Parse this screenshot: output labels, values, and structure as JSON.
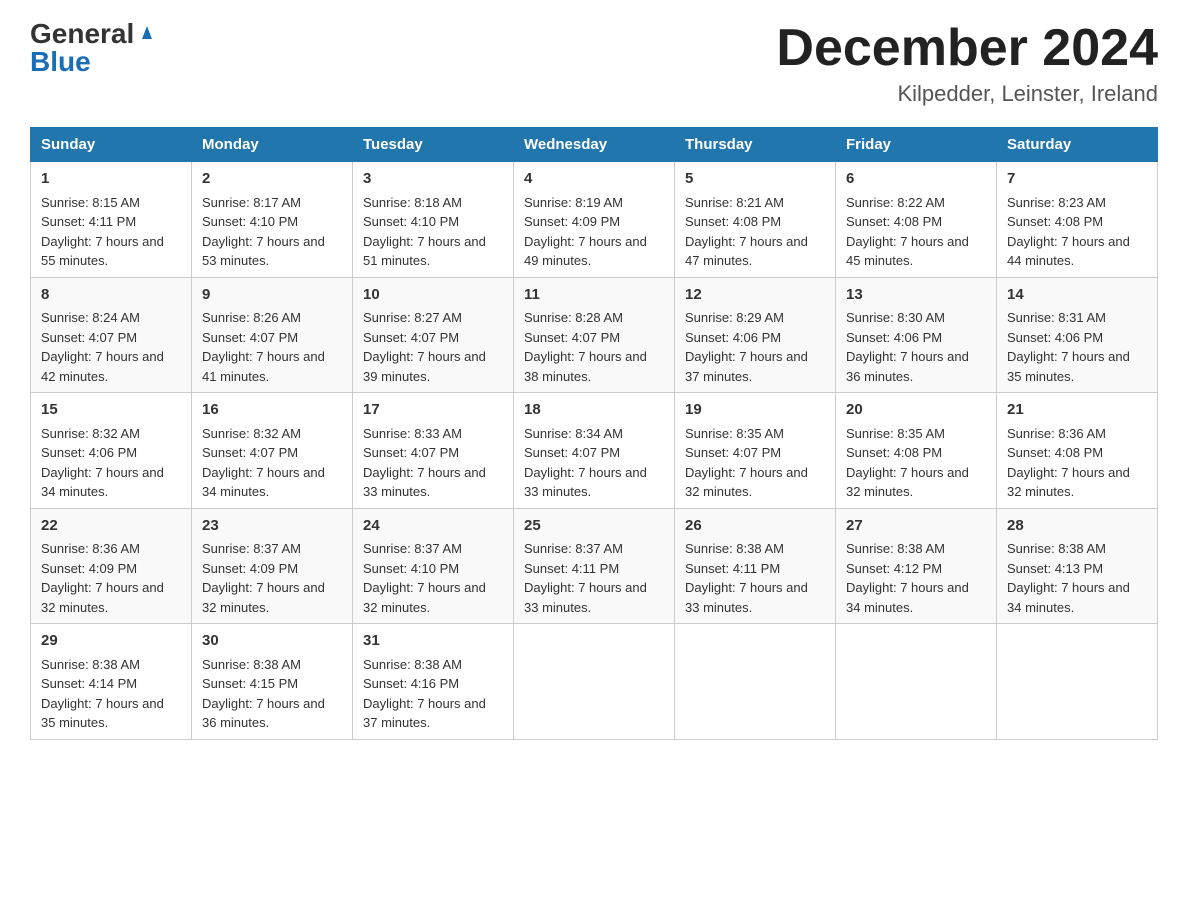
{
  "header": {
    "logo_general": "General",
    "logo_blue": "Blue",
    "month_title": "December 2024",
    "location": "Kilpedder, Leinster, Ireland"
  },
  "weekdays": [
    "Sunday",
    "Monday",
    "Tuesday",
    "Wednesday",
    "Thursday",
    "Friday",
    "Saturday"
  ],
  "weeks": [
    [
      {
        "day": "1",
        "sunrise": "8:15 AM",
        "sunset": "4:11 PM",
        "daylight": "7 hours and 55 minutes."
      },
      {
        "day": "2",
        "sunrise": "8:17 AM",
        "sunset": "4:10 PM",
        "daylight": "7 hours and 53 minutes."
      },
      {
        "day": "3",
        "sunrise": "8:18 AM",
        "sunset": "4:10 PM",
        "daylight": "7 hours and 51 minutes."
      },
      {
        "day": "4",
        "sunrise": "8:19 AM",
        "sunset": "4:09 PM",
        "daylight": "7 hours and 49 minutes."
      },
      {
        "day": "5",
        "sunrise": "8:21 AM",
        "sunset": "4:08 PM",
        "daylight": "7 hours and 47 minutes."
      },
      {
        "day": "6",
        "sunrise": "8:22 AM",
        "sunset": "4:08 PM",
        "daylight": "7 hours and 45 minutes."
      },
      {
        "day": "7",
        "sunrise": "8:23 AM",
        "sunset": "4:08 PM",
        "daylight": "7 hours and 44 minutes."
      }
    ],
    [
      {
        "day": "8",
        "sunrise": "8:24 AM",
        "sunset": "4:07 PM",
        "daylight": "7 hours and 42 minutes."
      },
      {
        "day": "9",
        "sunrise": "8:26 AM",
        "sunset": "4:07 PM",
        "daylight": "7 hours and 41 minutes."
      },
      {
        "day": "10",
        "sunrise": "8:27 AM",
        "sunset": "4:07 PM",
        "daylight": "7 hours and 39 minutes."
      },
      {
        "day": "11",
        "sunrise": "8:28 AM",
        "sunset": "4:07 PM",
        "daylight": "7 hours and 38 minutes."
      },
      {
        "day": "12",
        "sunrise": "8:29 AM",
        "sunset": "4:06 PM",
        "daylight": "7 hours and 37 minutes."
      },
      {
        "day": "13",
        "sunrise": "8:30 AM",
        "sunset": "4:06 PM",
        "daylight": "7 hours and 36 minutes."
      },
      {
        "day": "14",
        "sunrise": "8:31 AM",
        "sunset": "4:06 PM",
        "daylight": "7 hours and 35 minutes."
      }
    ],
    [
      {
        "day": "15",
        "sunrise": "8:32 AM",
        "sunset": "4:06 PM",
        "daylight": "7 hours and 34 minutes."
      },
      {
        "day": "16",
        "sunrise": "8:32 AM",
        "sunset": "4:07 PM",
        "daylight": "7 hours and 34 minutes."
      },
      {
        "day": "17",
        "sunrise": "8:33 AM",
        "sunset": "4:07 PM",
        "daylight": "7 hours and 33 minutes."
      },
      {
        "day": "18",
        "sunrise": "8:34 AM",
        "sunset": "4:07 PM",
        "daylight": "7 hours and 33 minutes."
      },
      {
        "day": "19",
        "sunrise": "8:35 AM",
        "sunset": "4:07 PM",
        "daylight": "7 hours and 32 minutes."
      },
      {
        "day": "20",
        "sunrise": "8:35 AM",
        "sunset": "4:08 PM",
        "daylight": "7 hours and 32 minutes."
      },
      {
        "day": "21",
        "sunrise": "8:36 AM",
        "sunset": "4:08 PM",
        "daylight": "7 hours and 32 minutes."
      }
    ],
    [
      {
        "day": "22",
        "sunrise": "8:36 AM",
        "sunset": "4:09 PM",
        "daylight": "7 hours and 32 minutes."
      },
      {
        "day": "23",
        "sunrise": "8:37 AM",
        "sunset": "4:09 PM",
        "daylight": "7 hours and 32 minutes."
      },
      {
        "day": "24",
        "sunrise": "8:37 AM",
        "sunset": "4:10 PM",
        "daylight": "7 hours and 32 minutes."
      },
      {
        "day": "25",
        "sunrise": "8:37 AM",
        "sunset": "4:11 PM",
        "daylight": "7 hours and 33 minutes."
      },
      {
        "day": "26",
        "sunrise": "8:38 AM",
        "sunset": "4:11 PM",
        "daylight": "7 hours and 33 minutes."
      },
      {
        "day": "27",
        "sunrise": "8:38 AM",
        "sunset": "4:12 PM",
        "daylight": "7 hours and 34 minutes."
      },
      {
        "day": "28",
        "sunrise": "8:38 AM",
        "sunset": "4:13 PM",
        "daylight": "7 hours and 34 minutes."
      }
    ],
    [
      {
        "day": "29",
        "sunrise": "8:38 AM",
        "sunset": "4:14 PM",
        "daylight": "7 hours and 35 minutes."
      },
      {
        "day": "30",
        "sunrise": "8:38 AM",
        "sunset": "4:15 PM",
        "daylight": "7 hours and 36 minutes."
      },
      {
        "day": "31",
        "sunrise": "8:38 AM",
        "sunset": "4:16 PM",
        "daylight": "7 hours and 37 minutes."
      },
      null,
      null,
      null,
      null
    ]
  ]
}
